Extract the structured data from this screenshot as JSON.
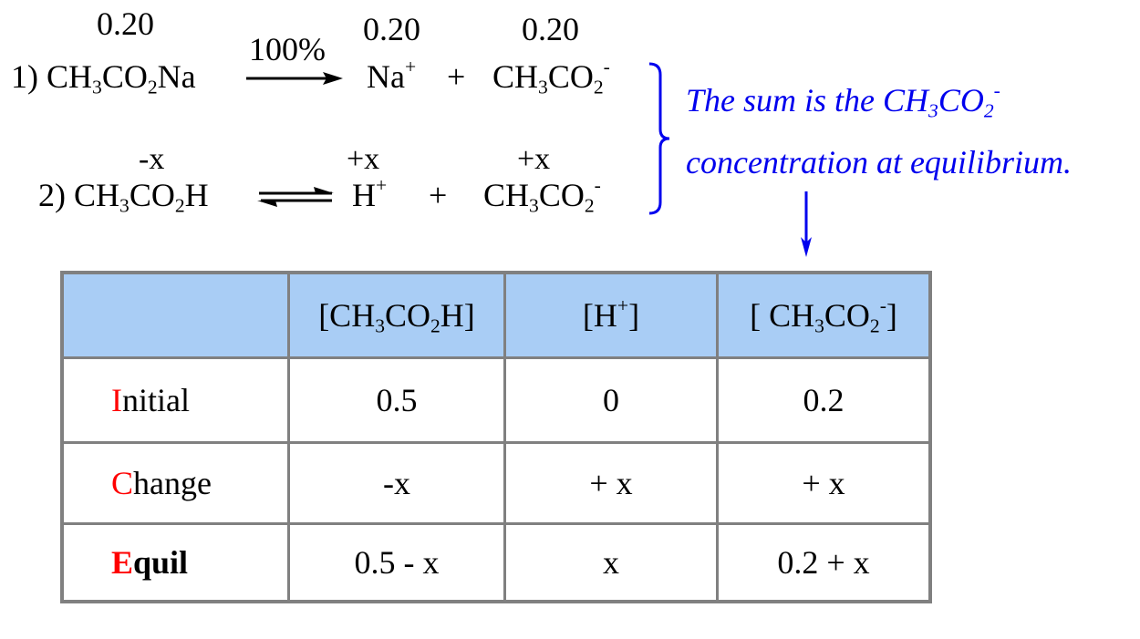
{
  "reaction1": {
    "label": "1)",
    "reactant": {
      "base": "CH",
      "s1": "3",
      "mid": "CO",
      "s2": "2",
      "tail": "Na"
    },
    "reactant_conc": "0.20",
    "arrow_label": "100%",
    "product1": {
      "base": "Na",
      "sup": "+"
    },
    "product1_conc": "0.20",
    "plus": "+",
    "product2": {
      "base": "CH",
      "s1": "3",
      "mid": "CO",
      "s2": "2",
      "sup": "-"
    },
    "product2_conc": "0.20"
  },
  "reaction2": {
    "label": "2)",
    "reactant": {
      "base": "CH",
      "s1": "3",
      "mid": "CO",
      "s2": "2",
      "tail": "H"
    },
    "reactant_change": "-x",
    "product1": {
      "base": "H",
      "sup": "+"
    },
    "product1_change": "+x",
    "plus": "+",
    "product2": {
      "base": "CH",
      "s1": "3",
      "mid": "CO",
      "s2": "2",
      "sup": "-"
    },
    "product2_change": "+x"
  },
  "annotation": {
    "line1_text": "The sum is the CH",
    "line1_s1": "3",
    "line1_mid": "CO",
    "line1_s2": "2",
    "line1_sup": "-",
    "line2": "concentration at equilibrium.",
    "color": "#0000ee"
  },
  "table": {
    "header_color": "#a9cdf5",
    "border_color": "#808080",
    "highlight_color": "#ff0000",
    "headers": [
      {
        "text": ""
      },
      {
        "open": "[CH",
        "s1": "3",
        "mid": "CO",
        "s2": "2",
        "close": "H]"
      },
      {
        "open": "[H",
        "sup": "+",
        "close": "]"
      },
      {
        "open": "[ CH",
        "s1": "3",
        "mid": "CO",
        "s2": "2",
        "sup": "-",
        "close": "]"
      }
    ],
    "rows": [
      {
        "label_first": "I",
        "label_rest": "nitial",
        "values": [
          "0.5",
          "0",
          "0.2"
        ]
      },
      {
        "label_first": "C",
        "label_rest": "hange",
        "values": [
          "-x",
          "+ x",
          "+ x"
        ]
      },
      {
        "label_first": "E",
        "label_rest": "quil",
        "values": [
          "0.5 - x",
          "x",
          "0.2 + x"
        ]
      }
    ]
  }
}
